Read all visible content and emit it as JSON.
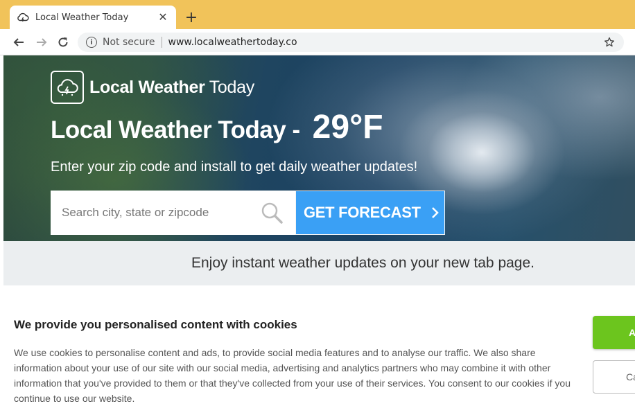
{
  "browser": {
    "tab_title": "Local Weather Today",
    "tab_close": "✕",
    "new_tab": "+",
    "security_label": "Not secure",
    "url": "www.localweathertoday.co",
    "icons": [
      "cloud-favicon-icon",
      "close-icon",
      "plus-icon",
      "back-arrow-icon",
      "forward-arrow-icon",
      "reload-icon",
      "info-icon",
      "bookmark-star-icon"
    ]
  },
  "hero": {
    "brand_bold": "Local Weather",
    "brand_light": "Today",
    "title": "Local Weather Today -",
    "temperature": "29°F",
    "subtitle": "Enter your zip code and install to get daily weather updates!",
    "search_placeholder": "Search city, state or zipcode",
    "search_value": "",
    "forecast_button": "GET FORECAST",
    "accent_color": "#3aa0f5"
  },
  "promo": {
    "text": "Enjoy instant weather updates on your new tab page."
  },
  "cookie": {
    "title": "We provide you personalised content with cookies",
    "body": "We use cookies to personalise content and ads, to provide social media features and to analyse our traffic. We also share information about your use of our site with our social media, advertising and analytics partners who may combine it with other information that you've provided to them or that they've collected from your use of their services. You consent to our cookies if you continue to use our website.",
    "accept_label": "A",
    "custom_label": "Ca",
    "accept_color": "#6cc51e"
  }
}
